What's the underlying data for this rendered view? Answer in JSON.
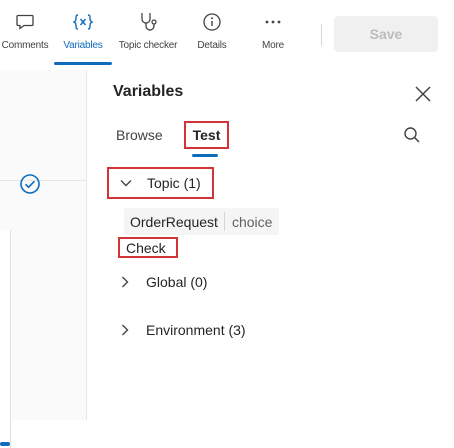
{
  "toolbar": {
    "items": [
      {
        "label": "Comments",
        "icon": "comment-icon"
      },
      {
        "label": "Variables",
        "icon": "variables-icon"
      },
      {
        "label": "Topic checker",
        "icon": "topic-checker-icon"
      },
      {
        "label": "Details",
        "icon": "info-icon"
      },
      {
        "label": "More",
        "icon": "more-icon"
      }
    ],
    "active_item": "Variables",
    "save_label": "Save"
  },
  "panel": {
    "title": "Variables",
    "tabs": [
      {
        "label": "Browse"
      },
      {
        "label": "Test"
      }
    ],
    "active_tab": "Test",
    "sections": {
      "topic": {
        "label": "Topic (1)",
        "expanded": true
      },
      "global": {
        "label": "Global (0)",
        "expanded": false
      },
      "environment": {
        "label": "Environment (3)",
        "expanded": false
      }
    },
    "variable": {
      "name": "OrderRequest",
      "type": "choice",
      "value": "Check"
    }
  },
  "colors": {
    "accent": "#0f6cbd",
    "highlight_border": "#d13438",
    "save_disabled_bg": "#f0f0f0",
    "save_disabled_text": "#bdbdbd"
  }
}
